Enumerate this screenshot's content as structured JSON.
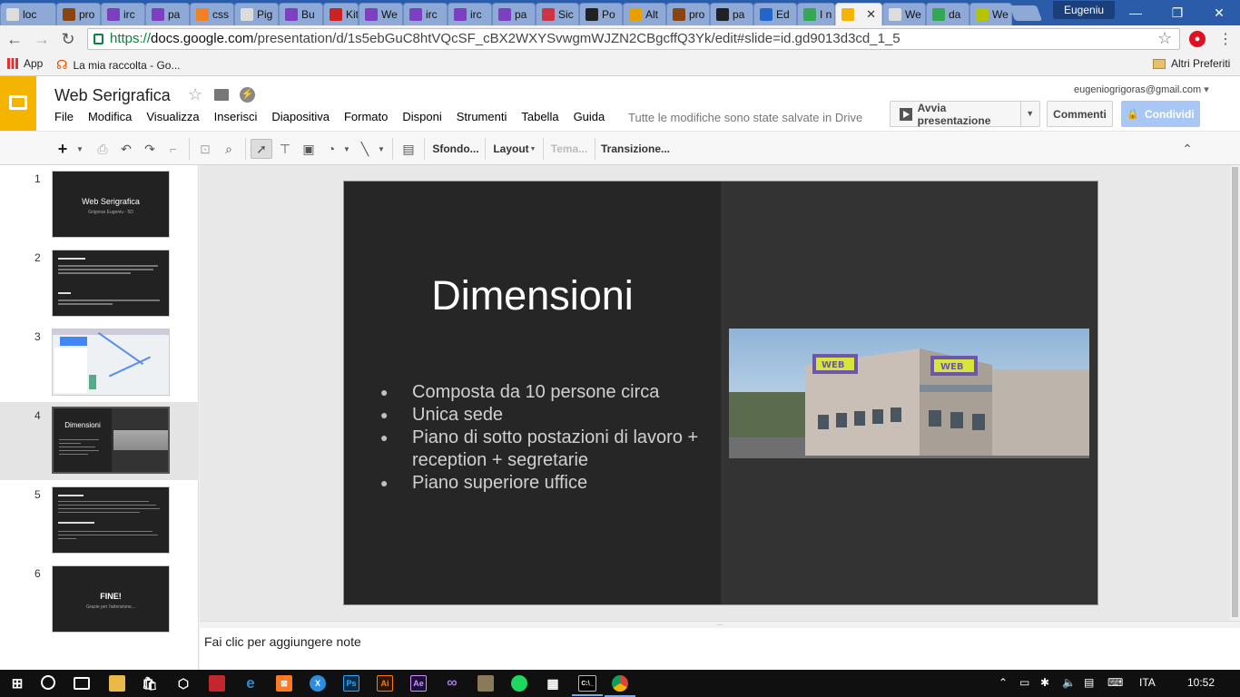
{
  "browser": {
    "tabs": [
      {
        "label": "loc",
        "icon": "document-icon",
        "color": "#dddddd"
      },
      {
        "label": "pro",
        "icon": "star-bookmark-icon",
        "color": "#8b4513"
      },
      {
        "label": "irc",
        "icon": "visual-studio-icon",
        "color": "#7b3fbf"
      },
      {
        "label": "pa",
        "icon": "visual-studio-icon",
        "color": "#7b3fbf"
      },
      {
        "label": "css",
        "icon": "stackoverflow-icon",
        "color": "#f48024"
      },
      {
        "label": "Pig",
        "icon": "document-icon",
        "color": "#dddddd"
      },
      {
        "label": "Bu",
        "icon": "visual-studio-icon",
        "color": "#7b3fbf"
      },
      {
        "label": "Kit",
        "icon": "record-icon",
        "color": "#cc2222"
      },
      {
        "label": "We",
        "icon": "visual-studio-icon",
        "color": "#7b3fbf"
      },
      {
        "label": "irc",
        "icon": "visual-studio-icon",
        "color": "#7b3fbf"
      },
      {
        "label": "irc",
        "icon": "visual-studio-icon",
        "color": "#7b3fbf"
      },
      {
        "label": "pa",
        "icon": "visual-studio-icon",
        "color": "#7b3fbf"
      },
      {
        "label": "Sic",
        "icon": "m-logo-icon",
        "color": "#cc3344"
      },
      {
        "label": "Po",
        "icon": "github-icon",
        "color": "#222222"
      },
      {
        "label": "Alt",
        "icon": "cheese-icon",
        "color": "#e8a000"
      },
      {
        "label": "pro",
        "icon": "star-bookmark-icon",
        "color": "#8b4513"
      },
      {
        "label": "pa",
        "icon": "github-icon",
        "color": "#222222"
      },
      {
        "label": "Ed",
        "icon": "edit-icon",
        "color": "#2266cc"
      },
      {
        "label": "I n",
        "icon": "drive-icon",
        "color": "#34a853"
      },
      {
        "label": "",
        "icon": "slides-icon",
        "color": "#f4b400"
      },
      {
        "label": "We",
        "icon": "document-icon",
        "color": "#dddddd"
      },
      {
        "label": "da",
        "icon": "maps-icon",
        "color": "#34a853"
      },
      {
        "label": "We",
        "icon": "w-logo-icon",
        "color": "#b5c400"
      }
    ],
    "active_tab_index": 19,
    "user": "Eugeniu",
    "url_scheme": "https://",
    "url_host": "docs.google.com",
    "url_path": "/presentation/d/1s5ebGuC8htVQcSF_cBX2WXYSvwgmWJZN2CBgcffQ3Yk/edit#slide=id.gd9013d3cd_1_5",
    "bookmarks": [
      {
        "label": "App",
        "icon": "apps-grid-icon"
      },
      {
        "label": "La mia raccolta - Go...",
        "icon": "headphones-icon"
      }
    ],
    "other_bookmarks": "Altri Preferiti"
  },
  "docs": {
    "title": "Web Serigrafica",
    "menu": [
      "File",
      "Modifica",
      "Visualizza",
      "Inserisci",
      "Diapositiva",
      "Formato",
      "Disponi",
      "Strumenti",
      "Tabella",
      "Guida"
    ],
    "save_status": "Tutte le modifiche sono state salvate in Drive",
    "account_email": "eugeniogrigoras@gmail.com",
    "present_label": "Avvia presentazione",
    "comments_label": "Commenti",
    "share_label": "Condividi",
    "toolbar": {
      "background_label": "Sfondo...",
      "layout_label": "Layout",
      "theme_label": "Tema...",
      "transition_label": "Transizione..."
    }
  },
  "slides": [
    {
      "num": "1",
      "title": "Web Serigrafica",
      "subtitle": "Grigoras Eugeniu - 5D"
    },
    {
      "num": "2",
      "title": "",
      "subtitle": ""
    },
    {
      "num": "3",
      "title": "",
      "subtitle": ""
    },
    {
      "num": "4",
      "title": "Dimensioni",
      "subtitle": ""
    },
    {
      "num": "5",
      "title": "",
      "subtitle": ""
    },
    {
      "num": "6",
      "title": "FINE!",
      "subtitle": "Grazie per l'attenzione..."
    }
  ],
  "selected_slide": 4,
  "current_slide": {
    "title": "Dimensioni",
    "bullets": [
      "Composta da 10 persone circa",
      "Unica sede",
      "Piano di sotto postazioni di lavoro + reception + segretarie",
      "Piano superiore uffice"
    ],
    "photo_sign": "WEB"
  },
  "notes_placeholder": "Fai clic per aggiungere note",
  "taskbar": {
    "apps": [
      {
        "label": "",
        "icon": "windows-start-icon"
      },
      {
        "label": "",
        "icon": "cortana-icon"
      },
      {
        "label": "",
        "icon": "task-view-icon"
      },
      {
        "label": "",
        "icon": "file-explorer-icon"
      },
      {
        "label": "",
        "icon": "store-icon"
      },
      {
        "label": "",
        "icon": "3d-box-icon"
      },
      {
        "label": "",
        "icon": "sketchup-icon"
      },
      {
        "label": "",
        "icon": "edge-icon"
      },
      {
        "label": "",
        "icon": "xampp-icon"
      },
      {
        "label": "",
        "icon": "x-app-icon"
      },
      {
        "label": "Ps",
        "icon": "photoshop-icon"
      },
      {
        "label": "Ai",
        "icon": "illustrator-icon"
      },
      {
        "label": "Ae",
        "icon": "after-effects-icon"
      },
      {
        "label": "",
        "icon": "visual-studio-icon"
      },
      {
        "label": "",
        "icon": "picture-viewer-icon"
      },
      {
        "label": "",
        "icon": "spotify-icon"
      },
      {
        "label": "",
        "icon": "calculator-icon"
      },
      {
        "label": "C:\\_",
        "icon": "command-prompt-icon"
      },
      {
        "label": "",
        "icon": "chrome-icon"
      }
    ],
    "language": "ITA",
    "clock": "10:52"
  },
  "colors": {
    "tabbar": "#2a5caa",
    "slides_yellow": "#f4b400",
    "share_blue": "#a9c7f5",
    "secure_green": "#0b8043"
  }
}
